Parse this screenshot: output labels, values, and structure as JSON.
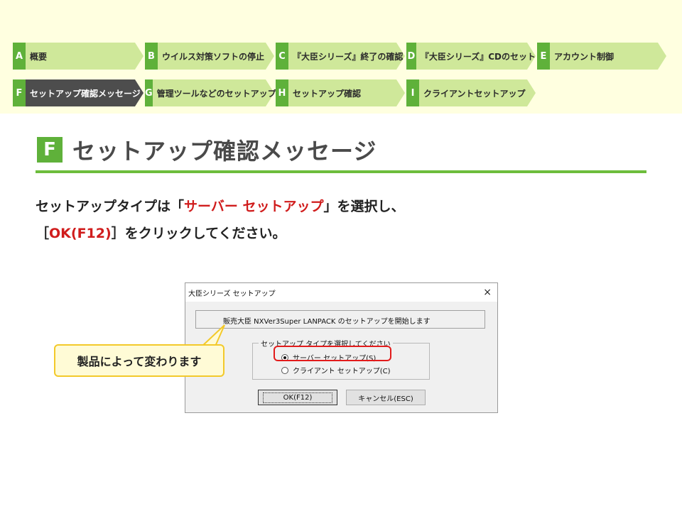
{
  "nav": {
    "row1": [
      {
        "letter": "A",
        "label": "概要"
      },
      {
        "letter": "B",
        "label": "ウイルス対策ソフトの停止"
      },
      {
        "letter": "C",
        "label": "『大臣シリーズ』終了の確認"
      },
      {
        "letter": "D",
        "label": "『大臣シリーズ』CDのセット"
      },
      {
        "letter": "E",
        "label": "アカウント制御"
      }
    ],
    "row2": [
      {
        "letter": "F",
        "label": "セットアップ確認メッセージ",
        "active": true
      },
      {
        "letter": "G",
        "label": "管理ツールなどのセットアップ"
      },
      {
        "letter": "H",
        "label": "セットアップ確認"
      },
      {
        "letter": "I",
        "label": "クライアントセットアップ"
      }
    ]
  },
  "heading": {
    "letter": "F",
    "title": "セットアップ確認メッセージ"
  },
  "instruction": {
    "line1_pre": "セットアップタイプは「",
    "line1_em": "サーバー セットアップ",
    "line1_post": "」を選択し、",
    "line2_pre": "［",
    "line2_em": "OK(F12)",
    "line2_post": "］をクリックしてください。"
  },
  "dialog": {
    "title": "大臣シリーズ セットアップ",
    "close": "×",
    "message": "販売大臣 NXVer3Super LANPACK のセットアップを開始します",
    "group_label": "セットアップ タイプを選択してください",
    "radio_server": "サーバー セットアップ(S)",
    "radio_client": "クライアント セットアップ(C)",
    "selected": "server",
    "ok_label": "OK(F12)",
    "cancel_label": "キャンセル(ESC)"
  },
  "callout": {
    "text": "製品によって変わります"
  },
  "colors": {
    "accent_green": "#5fb13a",
    "nav_fill": "#cfe89a",
    "active_step": "#4d4d4d",
    "emphasis_red": "#d01c1c",
    "callout_border": "#f3c92a"
  }
}
